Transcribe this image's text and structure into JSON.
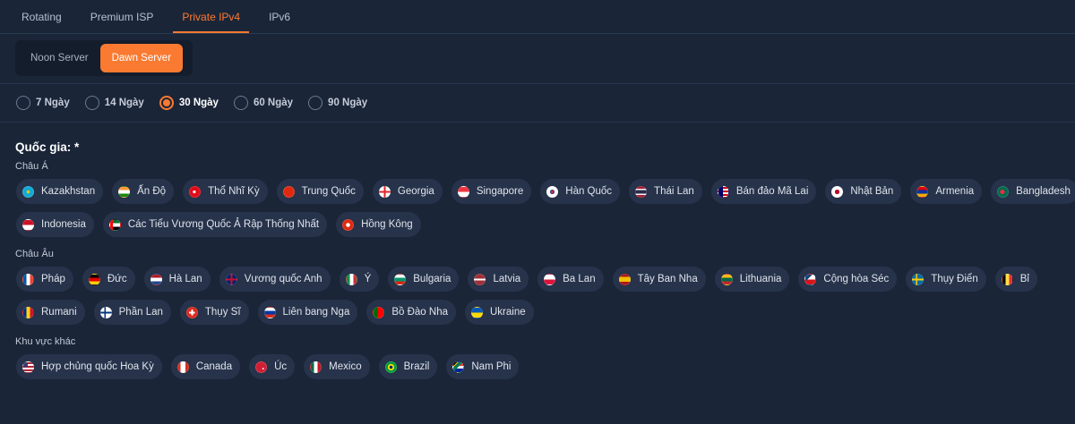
{
  "tabs": [
    {
      "label": "Rotating",
      "active": false
    },
    {
      "label": "Premium ISP",
      "active": false
    },
    {
      "label": "Private IPv4",
      "active": true
    },
    {
      "label": "IPv6",
      "active": false
    }
  ],
  "servers": [
    {
      "label": "Noon Server",
      "active": false
    },
    {
      "label": "Dawn Server",
      "active": true
    }
  ],
  "durations": [
    {
      "label": "7 Ngày",
      "checked": false
    },
    {
      "label": "14 Ngày",
      "checked": false
    },
    {
      "label": "30 Ngày",
      "checked": true
    },
    {
      "label": "60 Ngày",
      "checked": false
    },
    {
      "label": "90 Ngày",
      "checked": false
    }
  ],
  "country_title": "Quốc gia: *",
  "regions": {
    "asia": {
      "label": "Châu Á",
      "row1": [
        {
          "label": "Kazakhstan",
          "flag": "kazakhstan-flag-icon"
        },
        {
          "label": "Ấn Độ",
          "flag": "india-flag-icon"
        },
        {
          "label": "Thổ Nhĩ Kỳ",
          "flag": "turkey-flag-icon"
        },
        {
          "label": "Trung Quốc",
          "flag": "china-flag-icon"
        },
        {
          "label": "Georgia",
          "flag": "georgia-flag-icon"
        },
        {
          "label": "Singapore",
          "flag": "singapore-flag-icon"
        },
        {
          "label": "Hàn Quốc",
          "flag": "south-korea-flag-icon"
        },
        {
          "label": "Thái Lan",
          "flag": "thailand-flag-icon"
        },
        {
          "label": "Bán đảo Mã Lai",
          "flag": "malaysia-flag-icon"
        },
        {
          "label": "Nhật Bản",
          "flag": "japan-flag-icon"
        },
        {
          "label": "Armenia",
          "flag": "armenia-flag-icon"
        },
        {
          "label": "Bangladesh",
          "flag": "bangladesh-flag-icon"
        }
      ],
      "row2": [
        {
          "label": "Indonesia",
          "flag": "indonesia-flag-icon"
        },
        {
          "label": "Các Tiểu Vương Quốc Ả Rập Thống Nhất",
          "flag": "uae-flag-icon"
        },
        {
          "label": "Hồng Kông",
          "flag": "hong-kong-flag-icon"
        }
      ]
    },
    "europe": {
      "label": "Châu Âu",
      "row1": [
        {
          "label": "Pháp",
          "flag": "france-flag-icon"
        },
        {
          "label": "Đức",
          "flag": "germany-flag-icon"
        },
        {
          "label": "Hà Lan",
          "flag": "netherlands-flag-icon"
        },
        {
          "label": "Vương quốc Anh",
          "flag": "uk-flag-icon"
        },
        {
          "label": "Ý",
          "flag": "italy-flag-icon"
        },
        {
          "label": "Bulgaria",
          "flag": "bulgaria-flag-icon"
        },
        {
          "label": "Latvia",
          "flag": "latvia-flag-icon"
        },
        {
          "label": "Ba Lan",
          "flag": "poland-flag-icon"
        },
        {
          "label": "Tây Ban Nha",
          "flag": "spain-flag-icon"
        },
        {
          "label": "Lithuania",
          "flag": "lithuania-flag-icon"
        },
        {
          "label": "Cộng hòa Séc",
          "flag": "czech-flag-icon"
        },
        {
          "label": "Thụy Điển",
          "flag": "sweden-flag-icon"
        },
        {
          "label": "Bỉ",
          "flag": "belgium-flag-icon"
        }
      ],
      "row2": [
        {
          "label": "Rumani",
          "flag": "romania-flag-icon"
        },
        {
          "label": "Phần Lan",
          "flag": "finland-flag-icon"
        },
        {
          "label": "Thụy Sĩ",
          "flag": "switzerland-flag-icon"
        },
        {
          "label": "Liên bang Nga",
          "flag": "russia-flag-icon"
        },
        {
          "label": "Bồ Đào Nha",
          "flag": "portugal-flag-icon"
        },
        {
          "label": "Ukraine",
          "flag": "ukraine-flag-icon"
        }
      ]
    },
    "other": {
      "label": "Khu vực khác",
      "row1": [
        {
          "label": "Hợp chủng quốc Hoa Kỳ",
          "flag": "usa-flag-icon"
        },
        {
          "label": "Canada",
          "flag": "canada-flag-icon"
        },
        {
          "label": "Úc",
          "flag": "australia-flag-icon"
        },
        {
          "label": "Mexico",
          "flag": "mexico-flag-icon"
        },
        {
          "label": "Brazil",
          "flag": "brazil-flag-icon"
        },
        {
          "label": "Nam Phi",
          "flag": "south-africa-flag-icon"
        }
      ]
    }
  },
  "colors": {
    "background": "#1a2538",
    "accent": "#fa7a31",
    "chip": "#26334a"
  }
}
